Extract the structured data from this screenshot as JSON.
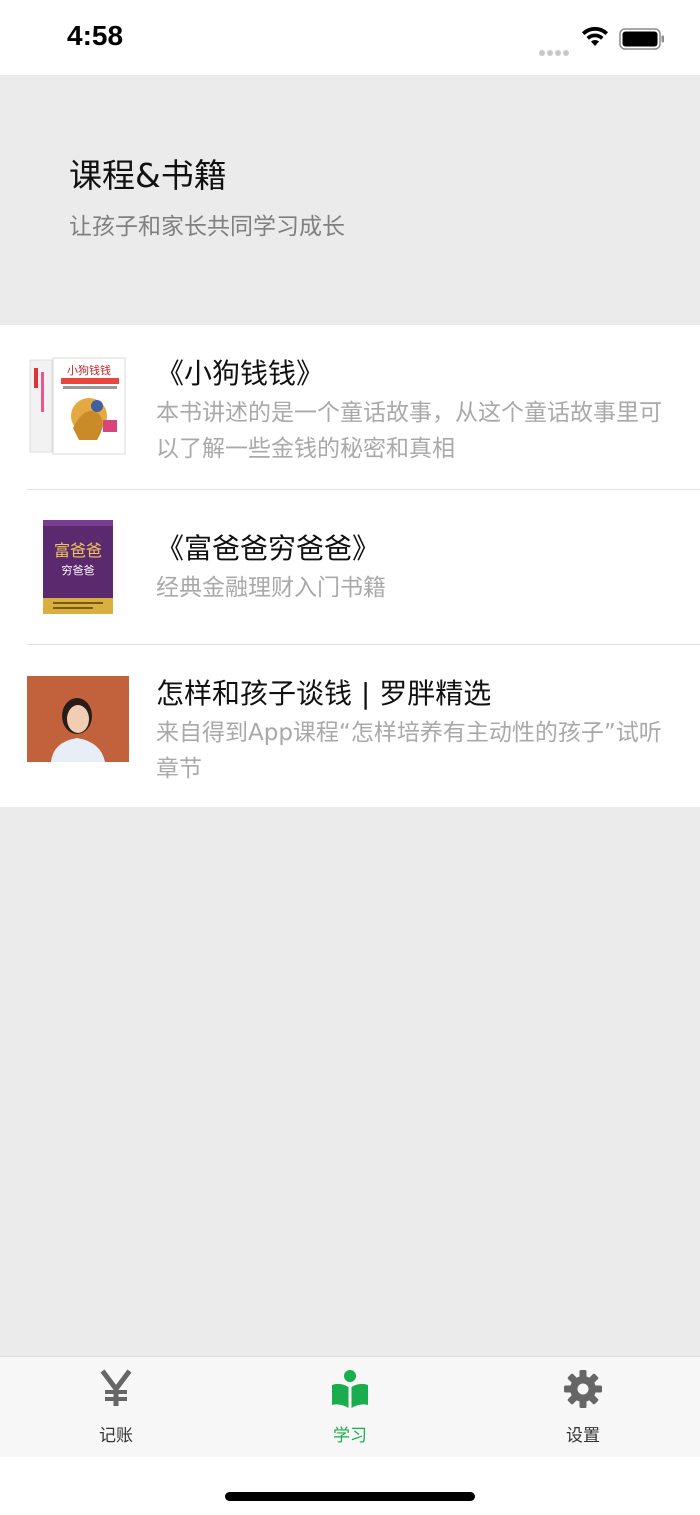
{
  "status_bar": {
    "time": "4:58"
  },
  "header": {
    "title": "课程&书籍",
    "subtitle": "让孩子和家长共同学习成长"
  },
  "items": [
    {
      "title": "《小狗钱钱》",
      "description": "本书讲述的是一个童话故事，从这个童话故事里可以了解一些金钱的秘密和真相",
      "cover_text": "小狗钱钱"
    },
    {
      "title": "《富爸爸穷爸爸》",
      "description": "经典金融理财入门书籍",
      "cover_text_top": "富爸爸",
      "cover_text_bottom": "穷爸爸"
    },
    {
      "title": "怎样和孩子谈钱 | 罗胖精选",
      "description": "来自得到App课程“怎样培养有主动性的孩子”试听章节"
    }
  ],
  "tabbar": {
    "tabs": [
      {
        "label": "记账",
        "icon": "yen-icon",
        "active": false
      },
      {
        "label": "学习",
        "icon": "book-icon",
        "active": true
      },
      {
        "label": "设置",
        "icon": "gear-icon",
        "active": false
      }
    ]
  },
  "colors": {
    "accent": "#1aad4e",
    "background": "#ebebeb",
    "secondary_text": "#a9a9a9"
  }
}
